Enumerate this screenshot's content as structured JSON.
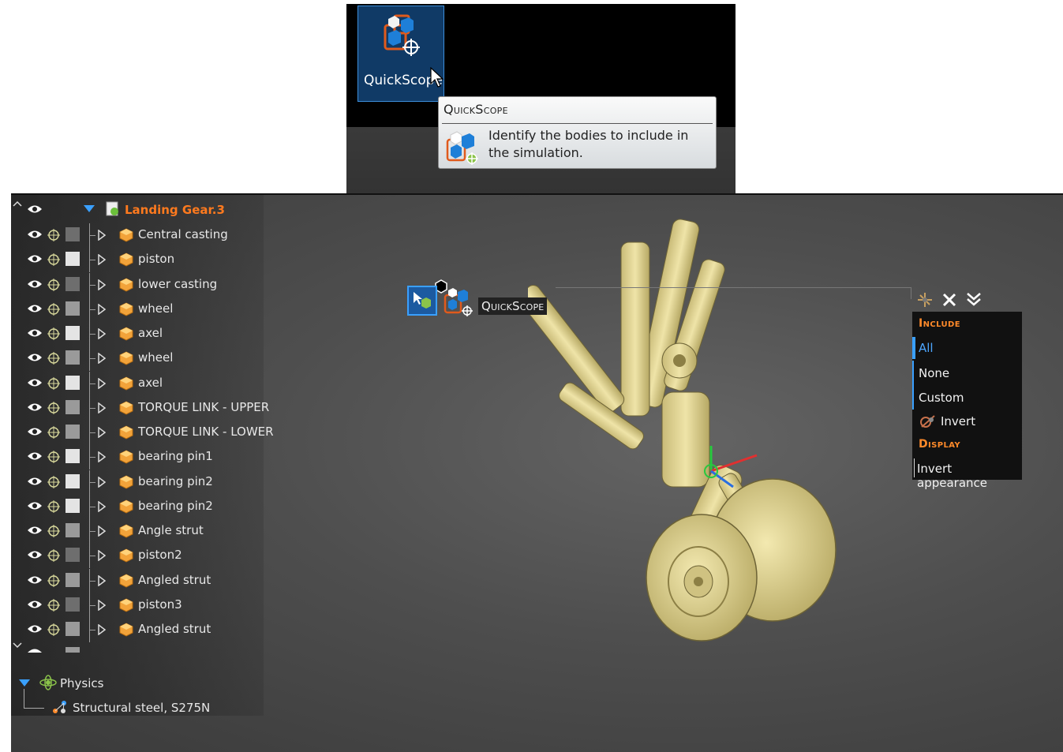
{
  "ribbon": {
    "button_label": "QuickScope"
  },
  "tooltip": {
    "title": "QuickScope",
    "description": "Identify the bodies to include in the simulation."
  },
  "tree": {
    "root_label": "Landing Gear.3",
    "items": [
      {
        "label": "Central casting",
        "swatch": "#6e6e6e"
      },
      {
        "label": "piston",
        "swatch": "#e4e4e4"
      },
      {
        "label": "lower casting",
        "swatch": "#6e6e6e"
      },
      {
        "label": "wheel",
        "swatch": "#9a9a9a"
      },
      {
        "label": "axel",
        "swatch": "#e4e4e4"
      },
      {
        "label": "wheel",
        "swatch": "#9a9a9a"
      },
      {
        "label": "axel",
        "swatch": "#e4e4e4"
      },
      {
        "label": "TORQUE LINK - UPPER",
        "swatch": "#9a9a9a"
      },
      {
        "label": "TORQUE LINK - LOWER",
        "swatch": "#9a9a9a"
      },
      {
        "label": "bearing pin1",
        "swatch": "#e4e4e4"
      },
      {
        "label": "bearing pin2",
        "swatch": "#e4e4e4"
      },
      {
        "label": "bearing pin2",
        "swatch": "#e4e4e4"
      },
      {
        "label": "Angle strut",
        "swatch": "#9a9a9a"
      },
      {
        "label": "piston2",
        "swatch": "#6e6e6e"
      },
      {
        "label": "Angled strut",
        "swatch": "#9a9a9a"
      },
      {
        "label": "piston3",
        "swatch": "#6e6e6e"
      },
      {
        "label": "Angled strut",
        "swatch": "#9a9a9a"
      }
    ],
    "physics_label": "Physics",
    "material_label": "Structural steel, S275N"
  },
  "viewport": {
    "tag_label": "QuickScope"
  },
  "include_panel": {
    "include_header": "Include",
    "options": [
      "All",
      "None",
      "Custom"
    ],
    "selected": "All",
    "invert_label": "Invert",
    "display_header": "Display",
    "invert_appearance_label": "Invert appearance"
  },
  "colors": {
    "accent_orange": "#ff7a1e",
    "selection_blue": "#3aa0ff",
    "model_cream": "#e8dc9a"
  }
}
